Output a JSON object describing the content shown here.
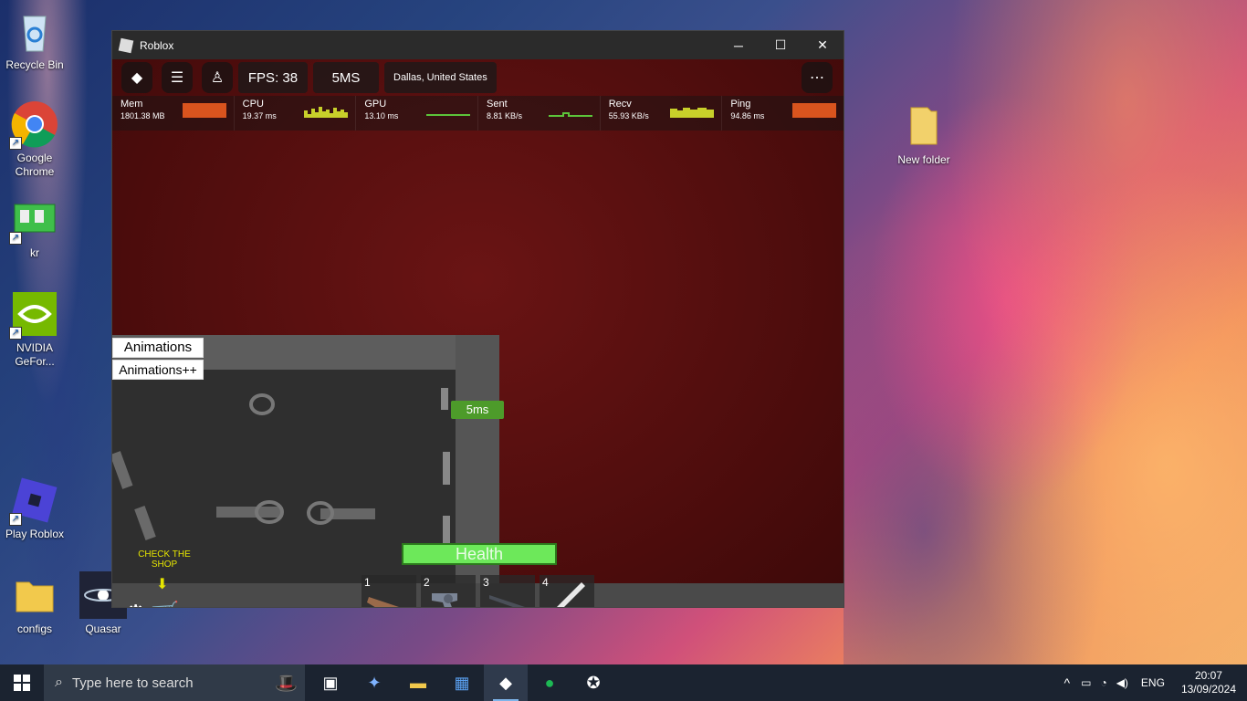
{
  "desktop": {
    "icons": [
      {
        "label": "Recycle Bin",
        "icon": "recycle-bin-icon"
      },
      {
        "label": "Google Chrome",
        "icon": "chrome-icon"
      },
      {
        "label": "kr",
        "icon": "kr-icon"
      },
      {
        "label": "NVIDIA GeFor...",
        "icon": "nvidia-icon"
      },
      {
        "label": "Play Roblox",
        "icon": "roblox-icon"
      },
      {
        "label": "configs",
        "icon": "folder-icon"
      },
      {
        "label": "Quasar",
        "icon": "quasar-icon"
      },
      {
        "label": "New folder",
        "icon": "folder-icon"
      }
    ]
  },
  "window": {
    "title": "Roblox",
    "controls": {
      "minimize": "─",
      "maximize": "☐",
      "close": "✕"
    }
  },
  "game": {
    "topbar": {
      "fps": "FPS: 38",
      "ms": "5MS",
      "location": "Dallas, United States"
    },
    "stats": [
      {
        "name": "Mem",
        "value": "1801.38 MB",
        "color": "#d9541e"
      },
      {
        "name": "CPU",
        "value": "19.37 ms",
        "color": "#c8d02a"
      },
      {
        "name": "GPU",
        "value": "13.10 ms",
        "color": "#5cc43a"
      },
      {
        "name": "Sent",
        "value": "8.81 KB/s",
        "color": "#5cc43a"
      },
      {
        "name": "Recv",
        "value": "55.93 KB/s",
        "color": "#c8d02a"
      },
      {
        "name": "Ping",
        "value": "94.86 ms",
        "color": "#d9541e"
      }
    ],
    "animations_label": "Animations",
    "animations_plus_label": "Animations++",
    "ping_badge": "5ms",
    "health_label": "Health",
    "hotbar": [
      {
        "slot": "1",
        "icon": "shotgun-icon"
      },
      {
        "slot": "2",
        "icon": "revolver-icon"
      },
      {
        "slot": "3",
        "icon": "rifle-icon"
      },
      {
        "slot": "4",
        "icon": "knife-icon"
      }
    ],
    "shop_hint": "CHECK THE SHOP"
  },
  "taskbar": {
    "search_placeholder": "Type here to search",
    "language": "ENG",
    "time": "20:07",
    "date": "13/09/2024"
  }
}
